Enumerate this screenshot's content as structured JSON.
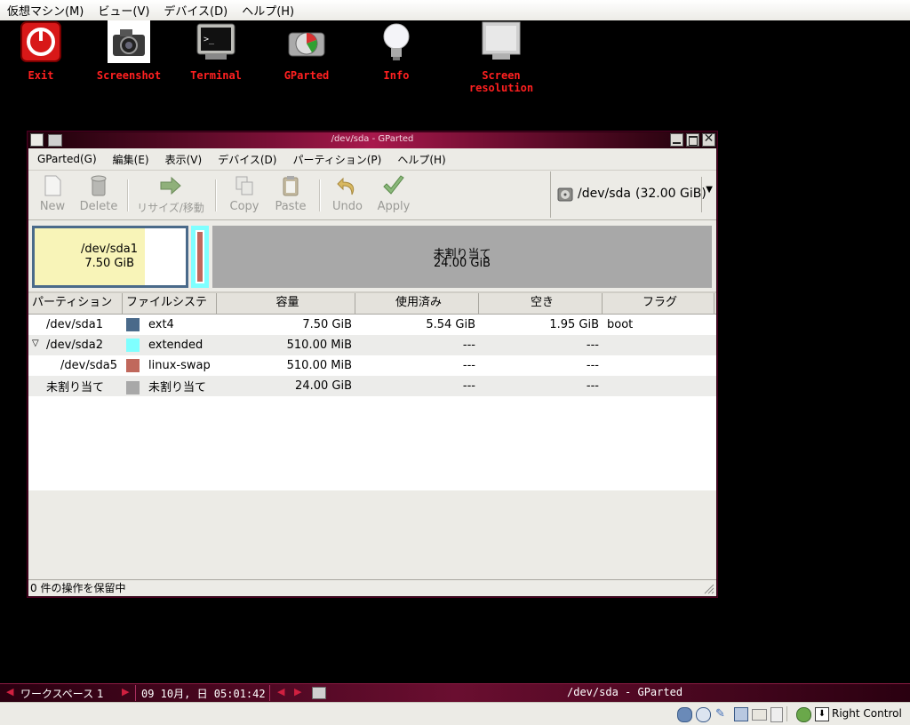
{
  "host_menu": {
    "machine": "仮想マシン(M)",
    "view": "ビュー(V)",
    "devices": "デバイス(D)",
    "help": "ヘルプ(H)"
  },
  "desktop_icons": [
    {
      "label": "Exit",
      "icon": "power-icon"
    },
    {
      "label": "Screenshot",
      "icon": "camera-icon"
    },
    {
      "label": "Terminal",
      "icon": "terminal-icon"
    },
    {
      "label": "GParted",
      "icon": "gparted-icon"
    },
    {
      "label": "Info",
      "icon": "lightbulb-icon"
    },
    {
      "label": "Screen resolution",
      "icon": "monitor-icon"
    }
  ],
  "window": {
    "title": "/dev/sda - GParted"
  },
  "menu": {
    "gparted": "GParted(G)",
    "edit": "編集(E)",
    "view": "表示(V)",
    "device": "デバイス(D)",
    "partition": "パーティション(P)",
    "help": "ヘルプ(H)"
  },
  "toolbar": {
    "new": "New",
    "delete": "Delete",
    "resize": "リサイズ/移動",
    "copy": "Copy",
    "paste": "Paste",
    "undo": "Undo",
    "apply": "Apply"
  },
  "device": {
    "name": "/dev/sda",
    "size": "(32.00 GiB)"
  },
  "graph": {
    "sda1_name": "/dev/sda1",
    "sda1_size": "7.50 GiB",
    "unalloc_name": "未割り当て",
    "unalloc_size": "24.00 GiB"
  },
  "columns": {
    "partition": "パーティション",
    "fs": "ファイルシステム",
    "size": "容量",
    "used": "使用済み",
    "free": "空き",
    "flags": "フラグ"
  },
  "rows": [
    {
      "partition": "/dev/sda1",
      "fs": "ext4",
      "size": "7.50 GiB",
      "used": "5.54 GiB",
      "free": "1.95 GiB",
      "flags": "boot",
      "color": "#4a6a8a",
      "expand": "",
      "indent": 0
    },
    {
      "partition": "/dev/sda2",
      "fs": "extended",
      "size": "510.00 MiB",
      "used": "---",
      "free": "---",
      "flags": "",
      "color": "#7fffff",
      "expand": "▽",
      "indent": 0
    },
    {
      "partition": "/dev/sda5",
      "fs": "linux-swap",
      "size": "510.00 MiB",
      "used": "---",
      "free": "---",
      "flags": "",
      "color": "#c0685c",
      "expand": "",
      "indent": 1
    },
    {
      "partition": "未割り当て",
      "fs": "未割り当て",
      "size": "24.00 GiB",
      "used": "---",
      "free": "---",
      "flags": "",
      "color": "#a8a8a8",
      "expand": "",
      "indent": 0
    }
  ],
  "status": {
    "text": "0 件の操作を保留中"
  },
  "taskbar": {
    "workspace": "ワークスペース 1",
    "clock": "09 10月, 日 05:01:42",
    "task": "/dev/sda - GParted"
  },
  "vbox_status": {
    "host_key": "Right Control"
  }
}
